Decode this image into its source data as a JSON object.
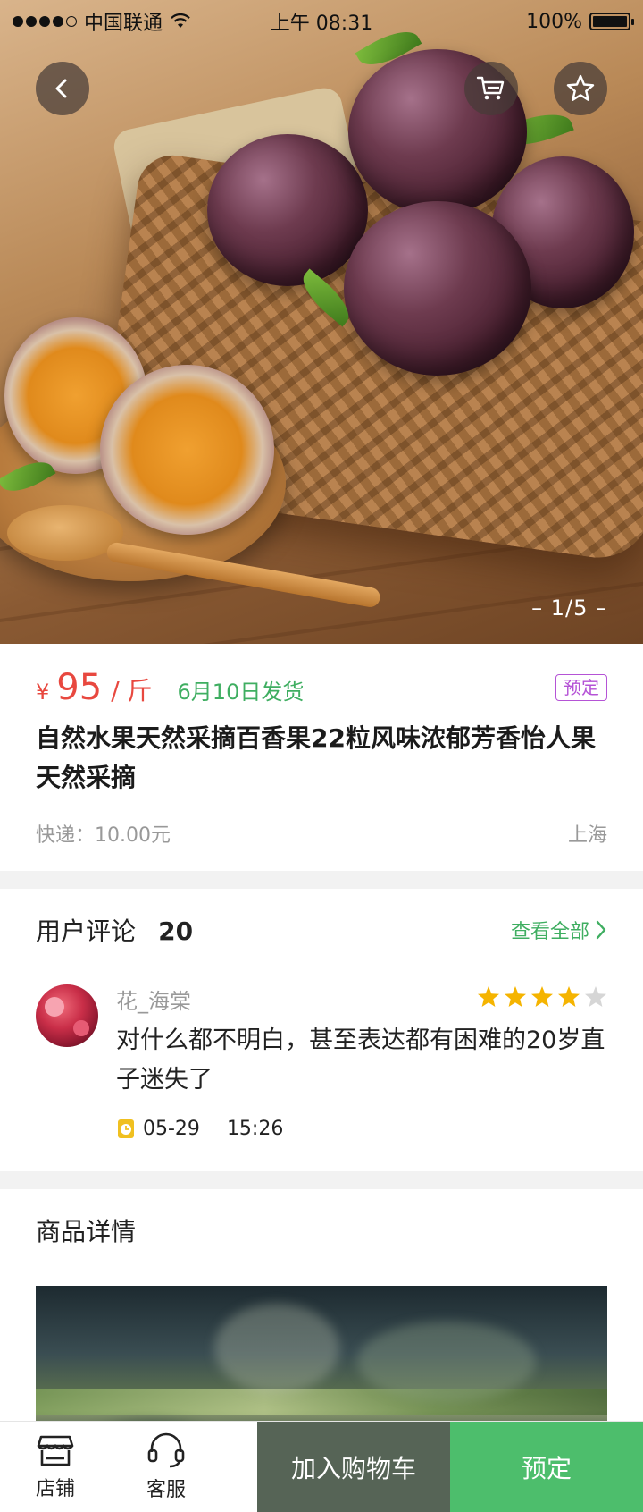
{
  "status_bar": {
    "carrier": "中国联通",
    "time": "上午 08:31",
    "battery": "100%"
  },
  "gallery": {
    "pager": "– 1/5 –"
  },
  "product": {
    "currency": "¥",
    "price": "95",
    "unit": "/ 斤",
    "ship_date": "6月10日发货",
    "tag": "预定",
    "title": "自然水果天然采摘百香果22粒风味浓郁芳香怡人果天然采摘",
    "shipping_fee": "快递：10.00元",
    "origin": "上海"
  },
  "reviews": {
    "title": "用户评论",
    "count": "20",
    "see_all": "查看全部",
    "items": [
      {
        "user": "花_海棠",
        "rating": 4,
        "max_rating": 5,
        "text": "对什么都不明白，甚至表达都有困难的20岁直子迷失了",
        "date": "05-29",
        "time": "15:26"
      }
    ]
  },
  "details": {
    "title": "商品详情"
  },
  "bottom_bar": {
    "shop_label": "店铺",
    "service_label": "客服",
    "add_to_cart": "加入购物车",
    "preorder": "预定"
  },
  "colors": {
    "price_red": "#e8483f",
    "accent_green": "#3fae61",
    "tag_purple": "#b553d6",
    "star_gold": "#f5b400",
    "cart_button": "#566456",
    "preorder_button": "#4dbe6c"
  },
  "icons": {
    "back": "chevron-left-icon",
    "cart": "cart-icon",
    "favorite": "star-outline-icon",
    "see_all": "chevron-right-icon",
    "time": "alarm-clock-icon",
    "shop": "store-icon",
    "service": "headset-icon"
  }
}
